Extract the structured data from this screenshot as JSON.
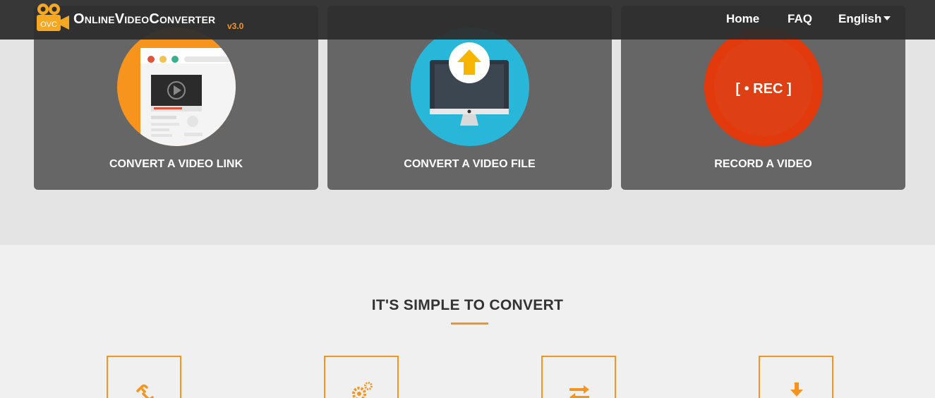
{
  "header": {
    "logo_badge": "OVC",
    "logo_title": "OnlineVideoConverter",
    "logo_version": "v3.0",
    "nav": {
      "home": "Home",
      "faq": "FAQ",
      "language": "English"
    }
  },
  "cards": [
    {
      "label": "CONVERT A VIDEO LINK",
      "icon": "browser-video-icon"
    },
    {
      "label": "CONVERT A VIDEO FILE",
      "icon": "monitor-upload-icon"
    },
    {
      "label": "RECORD A VIDEO",
      "icon": "rec-icon",
      "icon_text": "[ • REC ]"
    }
  ],
  "section": {
    "title": "IT'S SIMPLE TO CONVERT",
    "steps": [
      {
        "icon": "link-icon"
      },
      {
        "icon": "gears-icon"
      },
      {
        "icon": "convert-arrows-icon"
      },
      {
        "icon": "download-icon"
      }
    ]
  },
  "colors": {
    "accent": "#f7941d",
    "card": "#666666",
    "navbar": "#2d2d2d",
    "rec": "#e23a0d",
    "upload_bg": "#29b7d9"
  }
}
